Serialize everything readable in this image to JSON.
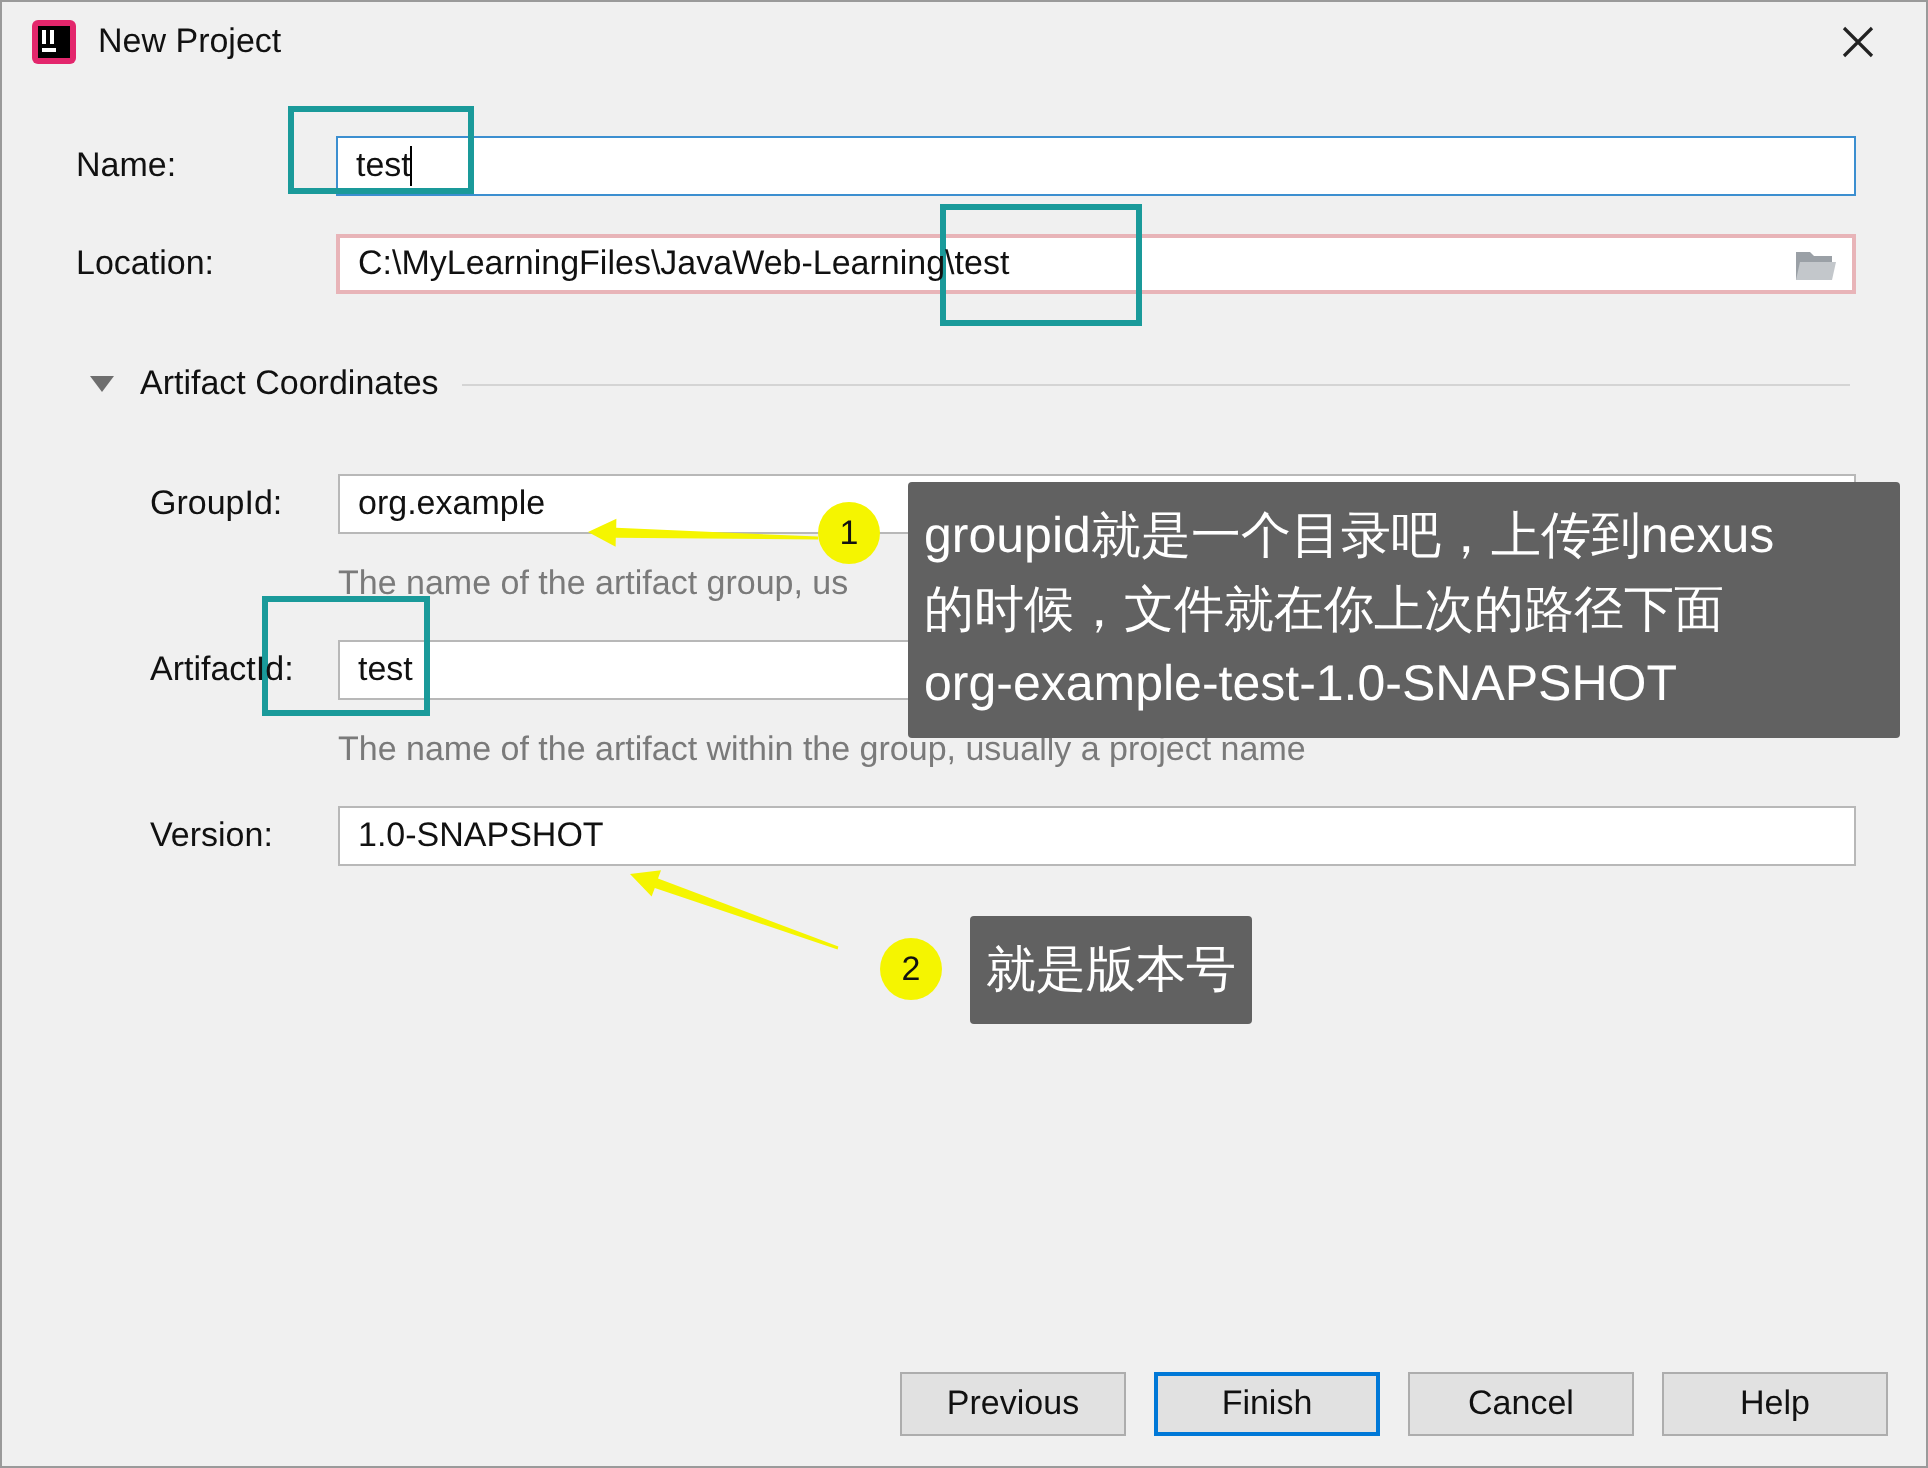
{
  "window": {
    "title": "New Project"
  },
  "fields": [
    {
      "label": "Name:",
      "value": "test",
      "focused": true,
      "error": false,
      "browse": false,
      "highlighted": true
    },
    {
      "label": "Location:",
      "value": "C:\\MyLearningFiles\\JavaWeb-Learning\\test",
      "focused": false,
      "error": true,
      "browse": true,
      "highlighted": true
    }
  ],
  "artifact_section": {
    "title": "Artifact Coordinates",
    "expanded": true,
    "fields": [
      {
        "label": "GroupId:",
        "value": "org.example",
        "hint": "The name of the artifact group, us"
      },
      {
        "label": "ArtifactId:",
        "value": "test",
        "hint": "The name of the artifact within the group, usually a project name",
        "highlighted": true
      },
      {
        "label": "Version:",
        "value": "1.0-SNAPSHOT"
      }
    ]
  },
  "callouts": [
    {
      "number": "1",
      "lines": [
        "groupid就是一个目录吧，上传到nexus",
        "的时候，文件就在你上次的路径下面",
        "org-example-test-1.0-SNAPSHOT"
      ]
    },
    {
      "number": "2",
      "lines": [
        "就是版本号"
      ]
    }
  ],
  "buttons": [
    {
      "label": "Previous",
      "default": false
    },
    {
      "label": "Finish",
      "default": true
    },
    {
      "label": "Cancel",
      "default": false
    },
    {
      "label": "Help",
      "default": false
    }
  ]
}
